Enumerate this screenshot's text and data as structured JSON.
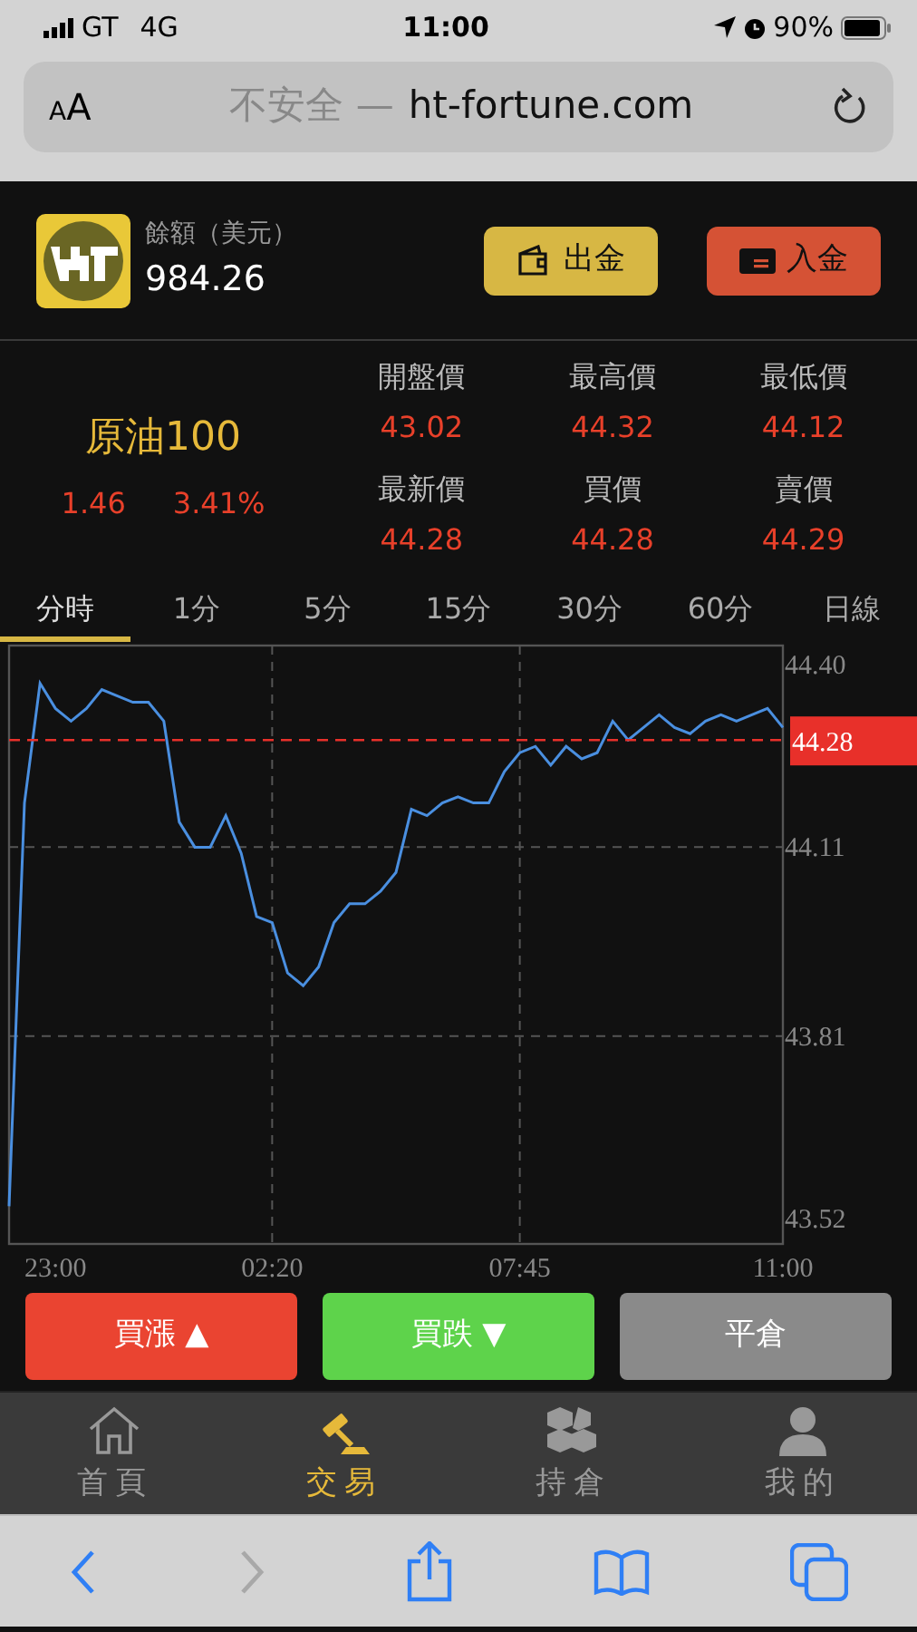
{
  "status_bar": {
    "carrier": "GT",
    "network": "4G",
    "time": "11:00",
    "battery": "90%"
  },
  "address_bar": {
    "format_button": "AA",
    "security": "不安全 —",
    "domain": "ht-fortune.com"
  },
  "account": {
    "label": "餘額（美元）",
    "balance": "984.26",
    "buttons": [
      {
        "kind": "withdraw",
        "label": "出金"
      },
      {
        "kind": "deposit",
        "label": "入金"
      }
    ]
  },
  "quote": {
    "name": "原油100",
    "change": "1.46",
    "change_percent": "3.41%",
    "fields": [
      {
        "label": "開盤價",
        "value": "43.02"
      },
      {
        "label": "最高價",
        "value": "44.32"
      },
      {
        "label": "最低價",
        "value": "44.12"
      },
      {
        "label": "最新價",
        "value": "44.28"
      },
      {
        "label": "買價",
        "value": "44.28"
      },
      {
        "label": "賣價",
        "value": "44.29"
      }
    ]
  },
  "periods": [
    {
      "label": "分時",
      "selected": true
    },
    {
      "label": "1分",
      "selected": false
    },
    {
      "label": "5分",
      "selected": false
    },
    {
      "label": "15分",
      "selected": false
    },
    {
      "label": "30分",
      "selected": false
    },
    {
      "label": "60分",
      "selected": false
    },
    {
      "label": "日線",
      "selected": false
    }
  ],
  "chart": {
    "current_price": "44.28",
    "chart_data": {
      "type": "line",
      "categories": [
        null,
        null,
        null,
        "23:00",
        null,
        null,
        null,
        null,
        null,
        null,
        null,
        null,
        null,
        null,
        null,
        null,
        null,
        "02:20",
        null,
        null,
        null,
        null,
        null,
        null,
        null,
        null,
        null,
        null,
        null,
        null,
        null,
        null,
        null,
        "07:45",
        null,
        null,
        null,
        null,
        null,
        null,
        null,
        null,
        null,
        null,
        null,
        null,
        null,
        null,
        null,
        null,
        "11:00"
      ],
      "series": [
        {
          "color": "#4a8fe0",
          "values": [
            43.54,
            44.18,
            44.37,
            44.33,
            44.31,
            44.33,
            44.36,
            44.35,
            44.34,
            44.34,
            44.31,
            44.15,
            44.11,
            44.11,
            44.16,
            44.1,
            44.0,
            43.99,
            43.91,
            43.89,
            43.92,
            43.99,
            44.02,
            44.02,
            44.04,
            44.07,
            44.17,
            44.16,
            44.18,
            44.19,
            44.18,
            44.18,
            44.23,
            44.26,
            44.27,
            44.24,
            44.27,
            44.25,
            44.26,
            44.31,
            44.28,
            44.3,
            44.32,
            44.3,
            44.29,
            44.31,
            44.32,
            44.31,
            44.32,
            44.33,
            44.3
          ]
        }
      ],
      "ylim": [
        43.48,
        44.43
      ],
      "grid": true,
      "ref_lines": [
        {
          "axis": "y",
          "value": 44.28,
          "color": "#e8302a"
        }
      ],
      "yticks": [
        {
          "value": 44.4,
          "label": "44.40"
        },
        {
          "value": 44.11,
          "label": "44.11"
        },
        {
          "value": 43.81,
          "label": "43.81"
        },
        {
          "value": 43.52,
          "label": "43.52"
        }
      ]
    }
  },
  "trade_buttons": [
    {
      "kind": "up",
      "label": "買漲 ▲"
    },
    {
      "kind": "down",
      "label": "買跌 ▼"
    },
    {
      "kind": "close",
      "label": "平倉"
    }
  ],
  "nav": [
    {
      "kind": "home",
      "label": "首頁",
      "selected": false
    },
    {
      "kind": "trade",
      "label": "交易",
      "selected": true
    },
    {
      "kind": "holdings",
      "label": "持倉",
      "selected": false
    },
    {
      "kind": "profile",
      "label": "我的",
      "selected": false
    }
  ],
  "toolbar": [
    {
      "kind": "back",
      "disabled": false
    },
    {
      "kind": "forward",
      "disabled": true
    },
    {
      "kind": "share",
      "disabled": false
    },
    {
      "kind": "bookmarks",
      "disabled": false
    },
    {
      "kind": "tabs",
      "disabled": false
    }
  ]
}
